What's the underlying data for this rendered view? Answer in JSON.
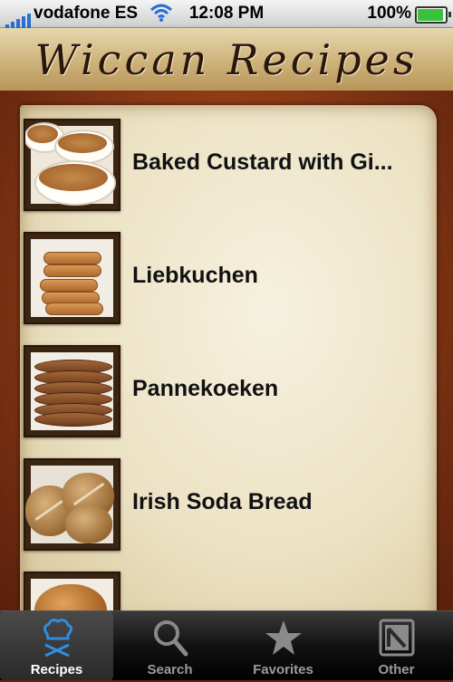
{
  "status_bar": {
    "carrier": "vodafone ES",
    "time": "12:08 PM",
    "battery": "100%",
    "battery_level": 1.0
  },
  "header": {
    "title": "Wiccan Recipes"
  },
  "recipes": [
    {
      "name": "Baked Custard with Gi...",
      "image": "custard-image"
    },
    {
      "name": "Liebkuchen",
      "image": "cookies-image"
    },
    {
      "name": "Pannekoeken",
      "image": "pancakes-image"
    },
    {
      "name": "Irish Soda Bread",
      "image": "soda-bread-image"
    },
    {
      "name": "",
      "image": "partial-item-image"
    }
  ],
  "tabs": [
    {
      "label": "Recipes",
      "icon": "chef-hat-icon",
      "active": true
    },
    {
      "label": "Search",
      "icon": "search-icon",
      "active": false
    },
    {
      "label": "Favorites",
      "icon": "star-icon",
      "active": false
    },
    {
      "label": "Other",
      "icon": "notebook-icon",
      "active": false
    }
  ],
  "colors": {
    "accent_active_icon": "#2f8de0",
    "inactive_tab_text": "#9c9c9c"
  }
}
